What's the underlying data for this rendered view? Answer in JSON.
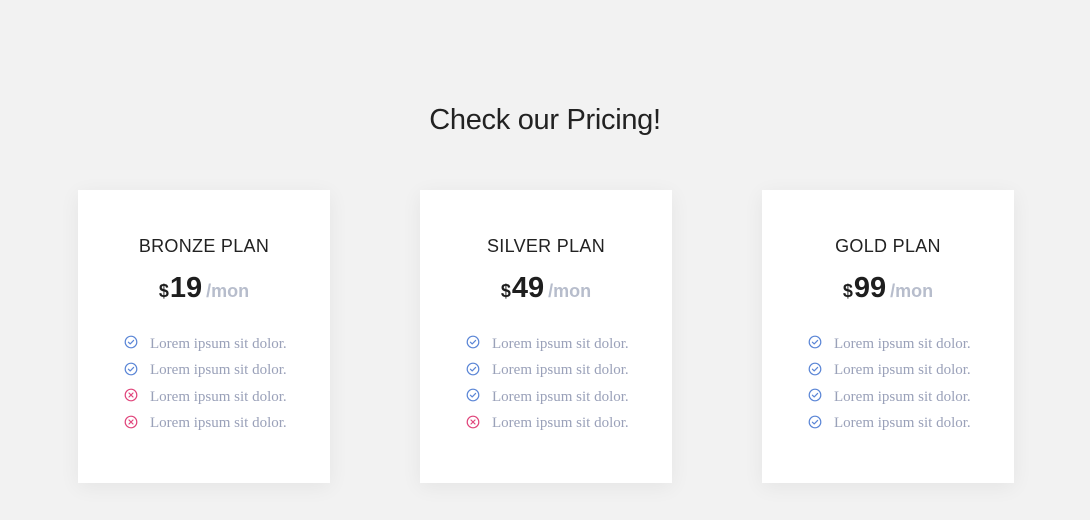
{
  "page": {
    "title": "Check our Pricing!"
  },
  "colors": {
    "background": "#f2f2f2",
    "card": "#ffffff",
    "check": "#5b86d6",
    "cross": "#e0457b",
    "period": "#b7bdcc",
    "feature_text": "#9aa1b9"
  },
  "plans": [
    {
      "name": "BRONZE PLAN",
      "currency": "$",
      "price": "19",
      "period": "/mon",
      "features": [
        {
          "text": "Lorem ipsum sit dolor.",
          "icon": "check-circle-icon",
          "included": true
        },
        {
          "text": "Lorem ipsum sit dolor.",
          "icon": "check-circle-icon",
          "included": true
        },
        {
          "text": "Lorem ipsum sit dolor.",
          "icon": "x-circle-icon",
          "included": false
        },
        {
          "text": "Lorem ipsum sit dolor.",
          "icon": "x-circle-icon",
          "included": false
        }
      ]
    },
    {
      "name": "SILVER PLAN",
      "currency": "$",
      "price": "49",
      "period": "/mon",
      "features": [
        {
          "text": "Lorem ipsum sit dolor.",
          "icon": "check-circle-icon",
          "included": true
        },
        {
          "text": "Lorem ipsum sit dolor.",
          "icon": "check-circle-icon",
          "included": true
        },
        {
          "text": "Lorem ipsum sit dolor.",
          "icon": "check-circle-icon",
          "included": true
        },
        {
          "text": "Lorem ipsum sit dolor.",
          "icon": "x-circle-icon",
          "included": false
        }
      ]
    },
    {
      "name": "GOLD PLAN",
      "currency": "$",
      "price": "99",
      "period": "/mon",
      "features": [
        {
          "text": "Lorem ipsum sit dolor.",
          "icon": "check-circle-icon",
          "included": true
        },
        {
          "text": "Lorem ipsum sit dolor.",
          "icon": "check-circle-icon",
          "included": true
        },
        {
          "text": "Lorem ipsum sit dolor.",
          "icon": "check-circle-icon",
          "included": true
        },
        {
          "text": "Lorem ipsum sit dolor.",
          "icon": "check-circle-icon",
          "included": true
        }
      ]
    }
  ]
}
